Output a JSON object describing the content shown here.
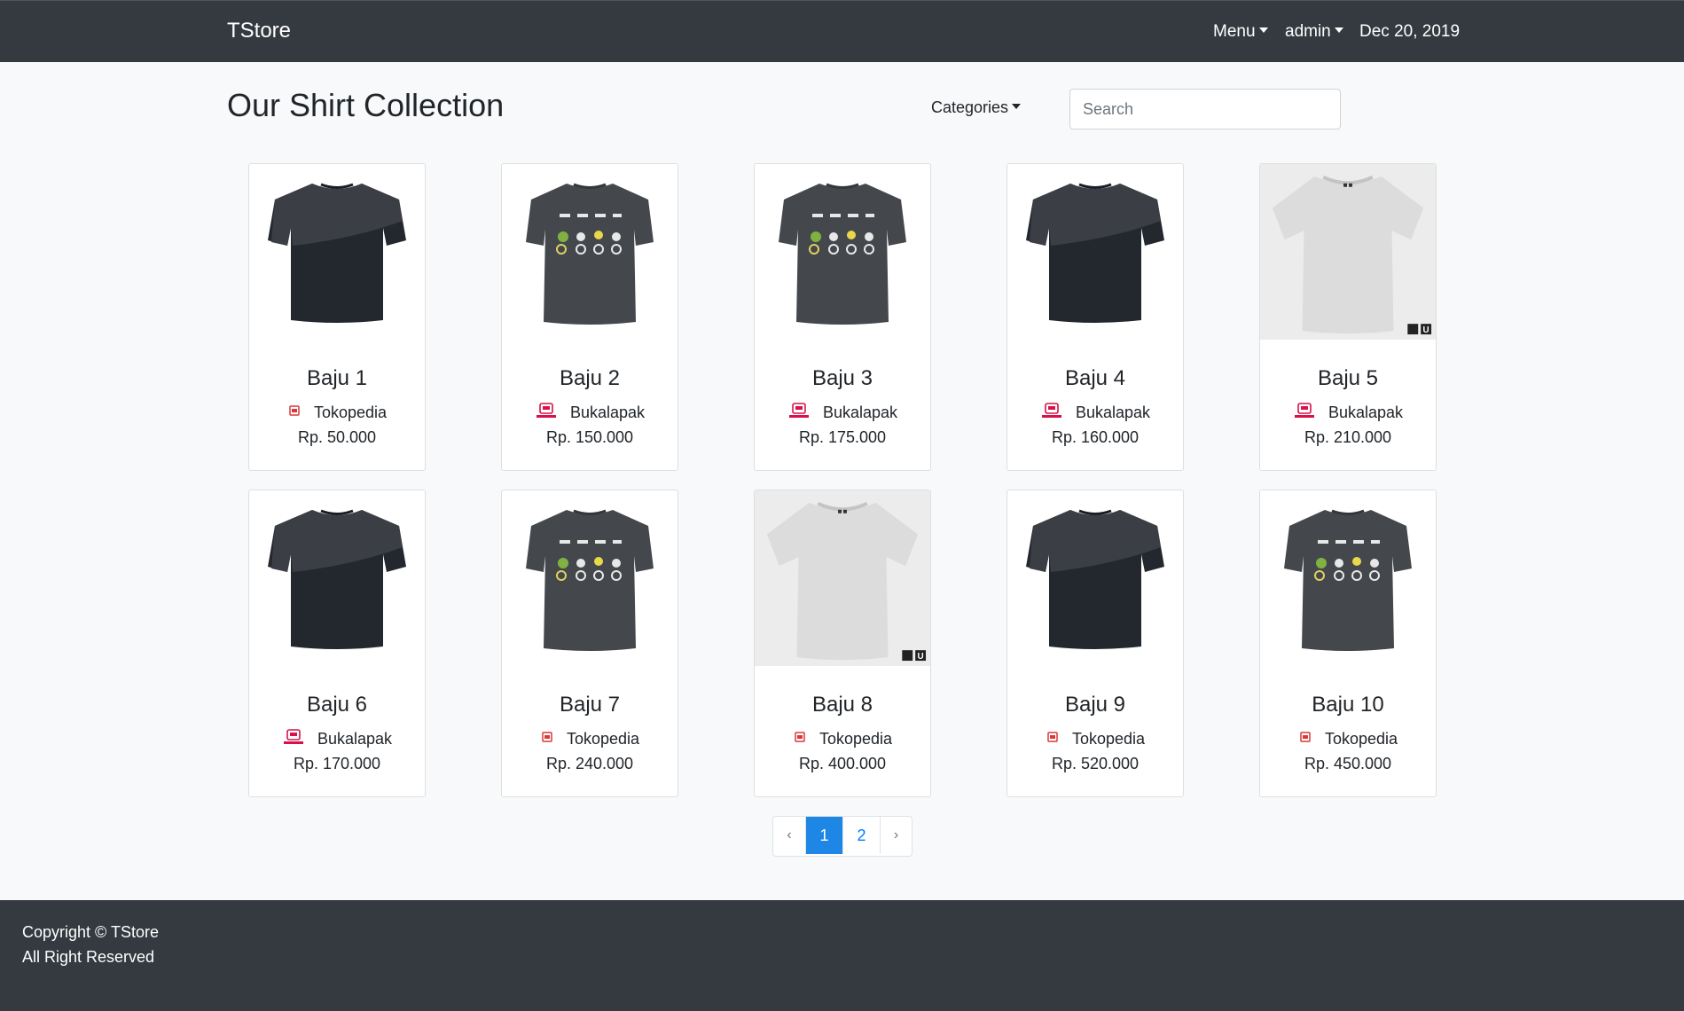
{
  "navbar": {
    "brand": "TStore",
    "menu_label": "Menu",
    "user_label": "admin",
    "date": "Dec 20, 2019"
  },
  "page": {
    "title": "Our Shirt Collection",
    "categories_label": "Categories",
    "search_placeholder": "Search"
  },
  "products": [
    {
      "name": "Baju 1",
      "store": "Tokopedia",
      "price": "Rp. 50.000",
      "image_icon": "dark-panel-tshirt-image"
    },
    {
      "name": "Baju 2",
      "store": "Bukalapak",
      "price": "Rp. 150.000",
      "image_icon": "graphic-tshirt-image"
    },
    {
      "name": "Baju 3",
      "store": "Bukalapak",
      "price": "Rp. 175.000",
      "image_icon": "graphic-tshirt-image"
    },
    {
      "name": "Baju 4",
      "store": "Bukalapak",
      "price": "Rp. 160.000",
      "image_icon": "dark-panel-tshirt-image"
    },
    {
      "name": "Baju 5",
      "store": "Bukalapak",
      "price": "Rp. 210.000",
      "image_icon": "grey-tshirt-image"
    },
    {
      "name": "Baju 6",
      "store": "Bukalapak",
      "price": "Rp. 170.000",
      "image_icon": "dark-panel-tshirt-image"
    },
    {
      "name": "Baju 7",
      "store": "Tokopedia",
      "price": "Rp. 240.000",
      "image_icon": "graphic-tshirt-image"
    },
    {
      "name": "Baju 8",
      "store": "Tokopedia",
      "price": "Rp. 400.000",
      "image_icon": "grey-tshirt-image"
    },
    {
      "name": "Baju 9",
      "store": "Tokopedia",
      "price": "Rp. 520.000",
      "image_icon": "dark-panel-tshirt-image"
    },
    {
      "name": "Baju 10",
      "store": "Tokopedia",
      "price": "Rp. 450.000",
      "image_icon": "graphic-tshirt-image"
    }
  ],
  "pagination": {
    "prev": "‹",
    "pages": [
      "1",
      "2"
    ],
    "active_page": "1",
    "next": "›"
  },
  "footer": {
    "copyright": "Copyright © TStore",
    "rights": "All Right Reserved"
  },
  "colors": {
    "navbar": "#343a40",
    "accent": "#1e87e5",
    "background": "#f8f9fa"
  }
}
